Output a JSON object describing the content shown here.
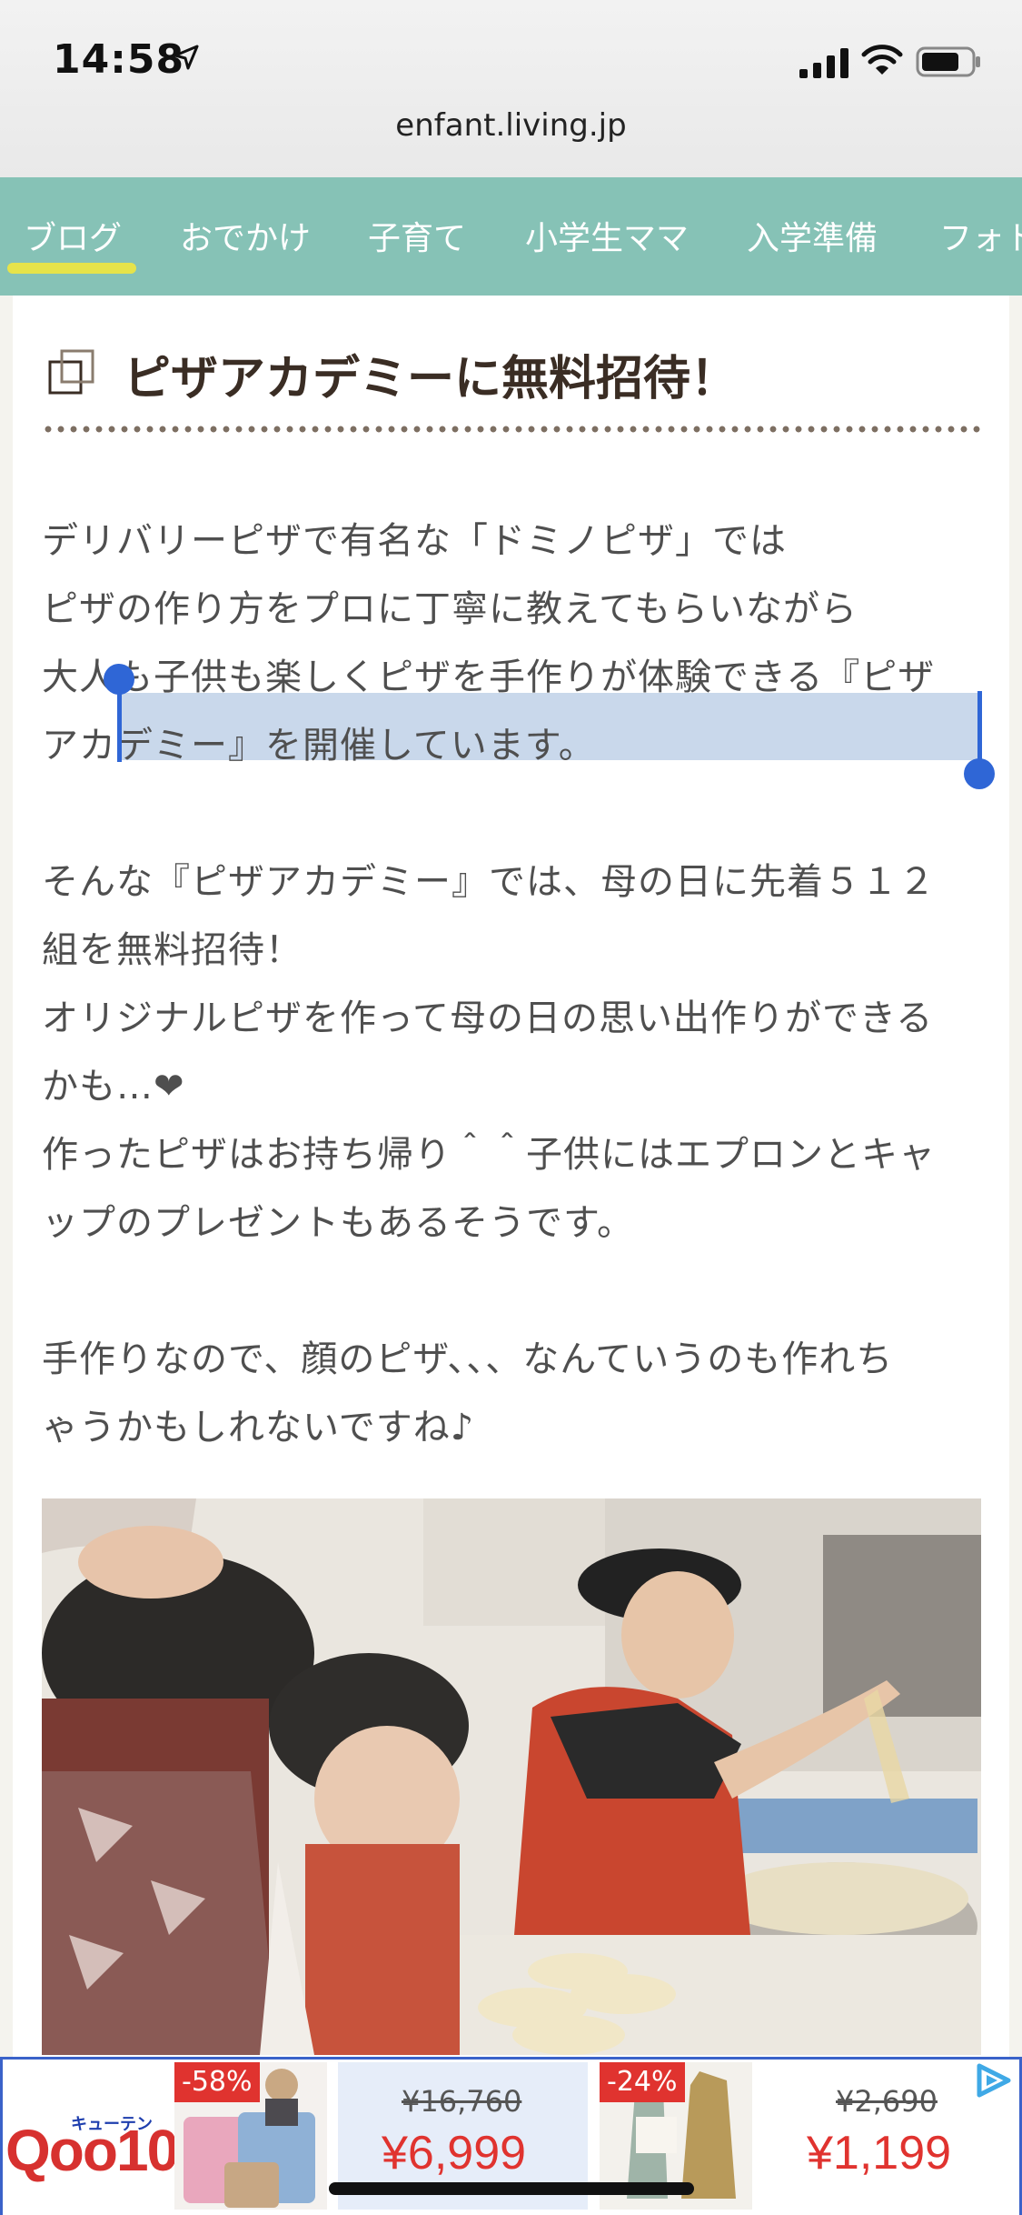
{
  "status_bar": {
    "time": "14:58",
    "url": "enfant.living.jp"
  },
  "nav": {
    "items": [
      "ブログ",
      "おでかけ",
      "子育て",
      "小学生ママ",
      "入学準備",
      "フォト"
    ]
  },
  "article": {
    "title": "ピザアカデミーに無料招待！",
    "lines": [
      "デリバリーピザで有名な「ドミノピザ」では",
      "ピザの作り方をプロに丁寧に教えてもらいながら",
      "大人も子供も楽しくピザを手作りが体験できる『ピザ",
      "アカデミー』を開催しています。",
      "そんな『ピザアカデミー』では、母の日に先着５１２",
      "組を無料招待！",
      "オリジナルピザを作って母の日の思い出作りができる",
      "かも…❤",
      "作ったピザはお持ち帰り＾＾子供にはエプロンとキャ",
      "ップのプレゼントもあるそうです。",
      "手作りなので、顔のピザ、、、なんていうのも作れち",
      "ゃうかもしれないですね♪"
    ]
  },
  "ad": {
    "logo_sub": "キューテン",
    "logo": "Qoo10",
    "products": [
      {
        "discount": "-58%",
        "old_price": "¥16,760",
        "price": "¥6,999"
      },
      {
        "discount": "-24%",
        "old_price": "¥2,690",
        "price": "¥1,199"
      }
    ]
  },
  "colors": {
    "nav_bg": "#86c2b6",
    "nav_underline": "#e6e34a",
    "selection": "#c9d8eb",
    "price_red": "#e0332f"
  }
}
